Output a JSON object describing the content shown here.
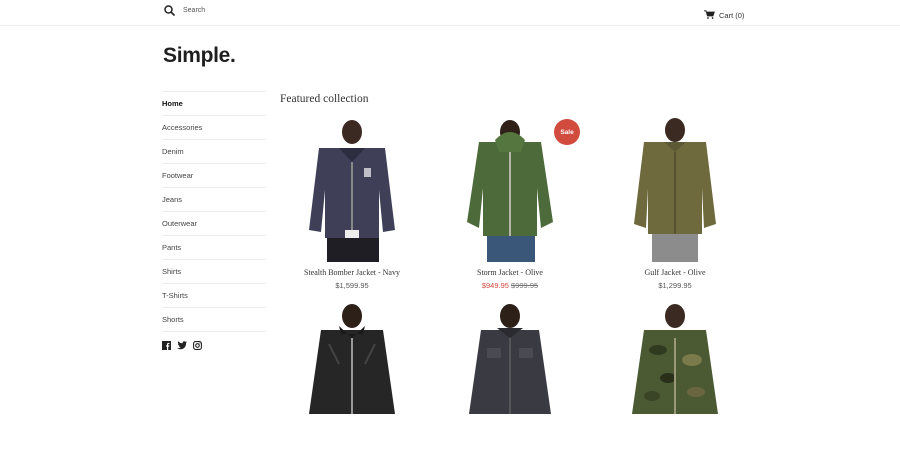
{
  "header": {
    "search_placeholder": "Search",
    "search_icon": "search-icon",
    "cart_label": "Cart (0)",
    "cart_icon": "cart-icon"
  },
  "store": {
    "logo": "Simple."
  },
  "sidebar": {
    "items": [
      {
        "label": "Home",
        "active": true
      },
      {
        "label": "Accessories"
      },
      {
        "label": "Denim"
      },
      {
        "label": "Footwear"
      },
      {
        "label": "Jeans"
      },
      {
        "label": "Outerwear"
      },
      {
        "label": "Pants"
      },
      {
        "label": "Shirts"
      },
      {
        "label": "T-Shirts"
      },
      {
        "label": "Shorts"
      }
    ],
    "social_icons": [
      "facebook-icon",
      "twitter-icon",
      "instagram-icon"
    ]
  },
  "featured": {
    "title": "Featured collection",
    "products": [
      {
        "name": "Stealth Bomber Jacket - Navy",
        "price": "$1,599.95"
      },
      {
        "name": "Storm Jacket - Olive",
        "sale_price": "$949.95",
        "original_price": "$999.95",
        "badge": "Sale"
      },
      {
        "name": "Gulf Jacket - Olive",
        "price": "$1,299.95"
      },
      {
        "name": "",
        "price": ""
      },
      {
        "name": "",
        "price": ""
      },
      {
        "name": "",
        "price": ""
      }
    ]
  },
  "colors": {
    "sale": "#d24b3f",
    "text": "#333333"
  }
}
